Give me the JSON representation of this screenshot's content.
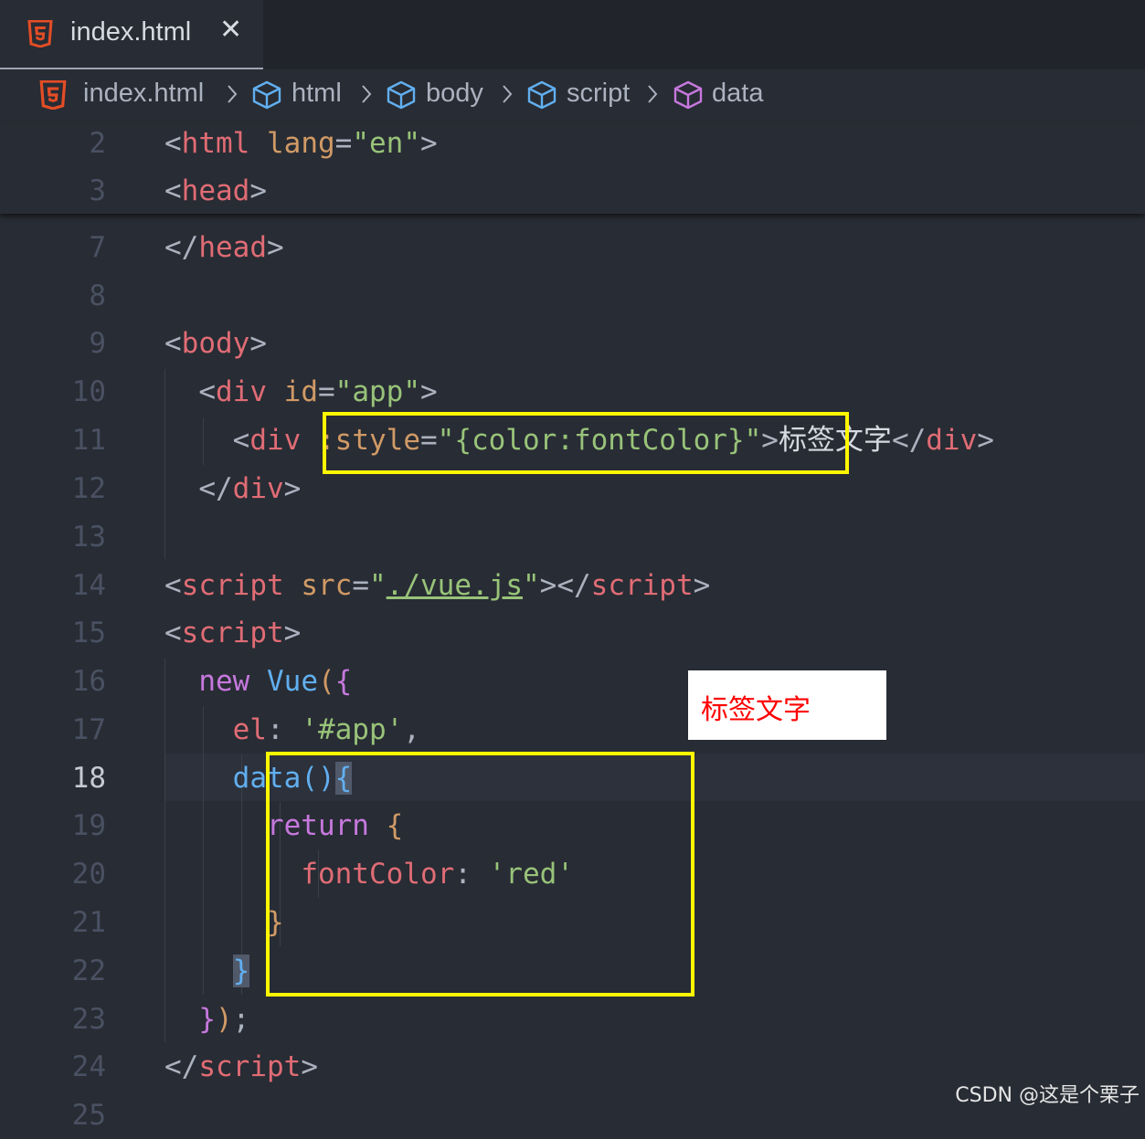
{
  "tab": {
    "title": "index.html",
    "close_glyph": "✕",
    "icon": "html5-icon"
  },
  "breadcrumb": [
    {
      "label": "index.html",
      "icon": "html5-icon"
    },
    {
      "label": "html",
      "icon": "cube-icon"
    },
    {
      "label": "body",
      "icon": "cube-icon"
    },
    {
      "label": "script",
      "icon": "cube-icon"
    },
    {
      "label": "data",
      "icon": "cube-icon"
    }
  ],
  "editor": {
    "active_line": "18",
    "line_numbers": [
      "2",
      "3",
      "7",
      "8",
      "9",
      "10",
      "11",
      "12",
      "13",
      "14",
      "15",
      "16",
      "17",
      "18",
      "19",
      "20",
      "21",
      "22",
      "23",
      "24",
      "25"
    ],
    "lines": {
      "l2": [
        [
          "<",
          "p"
        ],
        [
          "html",
          "t"
        ],
        [
          " ",
          "p"
        ],
        [
          "lang",
          "a"
        ],
        [
          "=",
          "p"
        ],
        [
          "\"en\"",
          "s"
        ],
        [
          ">",
          "p"
        ]
      ],
      "l3": [
        [
          "<",
          "p"
        ],
        [
          "head",
          "t"
        ],
        [
          ">",
          "p"
        ]
      ],
      "l7": [
        [
          "</",
          "p"
        ],
        [
          "head",
          "t"
        ],
        [
          ">",
          "p"
        ]
      ],
      "l9": [
        [
          "<",
          "p"
        ],
        [
          "body",
          "t"
        ],
        [
          ">",
          "p"
        ]
      ],
      "l10": [
        [
          "  <",
          "p"
        ],
        [
          "div",
          "t"
        ],
        [
          " ",
          "p"
        ],
        [
          "id",
          "a"
        ],
        [
          "=",
          "p"
        ],
        [
          "\"app\"",
          "s"
        ],
        [
          ">",
          "p"
        ]
      ],
      "l11": [
        [
          "    <",
          "p"
        ],
        [
          "div",
          "t"
        ],
        [
          " ",
          "p"
        ],
        [
          ":style",
          "a"
        ],
        [
          "=",
          "p"
        ],
        [
          "\"{color:fontColor}\"",
          "s"
        ],
        [
          ">",
          "p"
        ],
        [
          "标签文字",
          "g"
        ],
        [
          "</",
          "p"
        ],
        [
          "div",
          "t"
        ],
        [
          ">",
          "p"
        ]
      ],
      "l12": [
        [
          "  </",
          "p"
        ],
        [
          "div",
          "t"
        ],
        [
          ">",
          "p"
        ]
      ],
      "l14": [
        [
          "<",
          "p"
        ],
        [
          "script",
          "t"
        ],
        [
          " ",
          "p"
        ],
        [
          "src",
          "a"
        ],
        [
          "=",
          "p"
        ],
        [
          "\"",
          "s"
        ],
        [
          "./vue.js",
          "s ul"
        ],
        [
          "\"",
          "s"
        ],
        [
          "></",
          "p"
        ],
        [
          "script",
          "t"
        ],
        [
          ">",
          "p"
        ]
      ],
      "l15": [
        [
          "<",
          "p"
        ],
        [
          "script",
          "t"
        ],
        [
          ">",
          "p"
        ]
      ],
      "l16": [
        [
          "  ",
          "p"
        ],
        [
          "new",
          "k"
        ],
        [
          " ",
          "p"
        ],
        [
          "Vue",
          "f"
        ],
        [
          "(",
          "a"
        ],
        [
          "{",
          "k"
        ]
      ],
      "l17": [
        [
          "    ",
          "p"
        ],
        [
          "el",
          "t"
        ],
        [
          ": ",
          "p"
        ],
        [
          "'#app'",
          "s"
        ],
        [
          ",",
          "p"
        ]
      ],
      "l18": [
        [
          "    ",
          "p"
        ],
        [
          "data",
          "f"
        ],
        [
          "()",
          "f"
        ],
        [
          "{",
          "f hl-brace"
        ]
      ],
      "l19": [
        [
          "      ",
          "p"
        ],
        [
          "return",
          "k"
        ],
        [
          " ",
          "p"
        ],
        [
          "{",
          "a"
        ]
      ],
      "l20": [
        [
          "        ",
          "p"
        ],
        [
          "fontColor",
          "t"
        ],
        [
          ": ",
          "p"
        ],
        [
          "'red'",
          "s"
        ]
      ],
      "l21": [
        [
          "      ",
          "p"
        ],
        [
          "}",
          "a"
        ]
      ],
      "l22": [
        [
          "    ",
          "p"
        ],
        [
          "}",
          "f hl-brace"
        ]
      ],
      "l23": [
        [
          "  ",
          "p"
        ],
        [
          "}",
          "k"
        ],
        [
          ")",
          "a"
        ],
        [
          ";",
          "p"
        ]
      ],
      "l24": [
        [
          "</",
          "p"
        ],
        [
          "script",
          "t"
        ],
        [
          ">",
          "p"
        ]
      ]
    }
  },
  "preview": {
    "text": "标签文字"
  },
  "watermark": "CSDN @这是个栗子",
  "colors": {
    "highlight_box": "#fff700",
    "preview_text": "#ff0000",
    "tag": "#e06c75",
    "attribute": "#d19a66",
    "string": "#98c379",
    "keyword": "#c678dd",
    "function": "#61afef"
  }
}
